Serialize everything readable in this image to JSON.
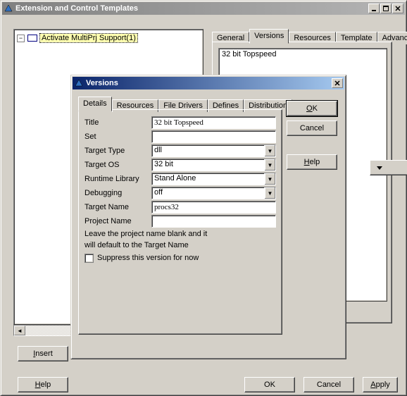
{
  "main": {
    "title": "Extension and Control Templates",
    "tree_item": "Activate MultiPrj Support(1)",
    "tabs": [
      "General",
      "Versions",
      "Resources",
      "Template",
      "Advanced"
    ],
    "active_tab": "Versions",
    "list_item": "32 bit Topspeed",
    "insert": "Insert",
    "help": "Help",
    "ok": "OK",
    "cancel": "Cancel",
    "apply": "Apply"
  },
  "dlg": {
    "title": "Versions",
    "tabs": [
      "Details",
      "Resources",
      "File Drivers",
      "Defines",
      "Distribution"
    ],
    "active_tab": "Details",
    "ok": "OK",
    "cancel": "Cancel",
    "help": "Help",
    "fields": {
      "title_label": "Title",
      "title_value": "32 bit Topspeed",
      "set_label": "Set",
      "set_value": "",
      "target_type_label": "Target Type",
      "target_type_value": "dll",
      "target_os_label": "Target OS",
      "target_os_value": "32 bit",
      "runtime_label": "Runtime Library",
      "runtime_value": "Stand Alone",
      "debugging_label": "Debugging",
      "debugging_value": "off",
      "target_name_label": "Target Name",
      "target_name_value": "procs32",
      "project_name_label": "Project Name",
      "project_name_value": "",
      "note1": "Leave the project name blank and it",
      "note2": "will default to the Target Name",
      "suppress": "Suppress this version for now"
    }
  }
}
